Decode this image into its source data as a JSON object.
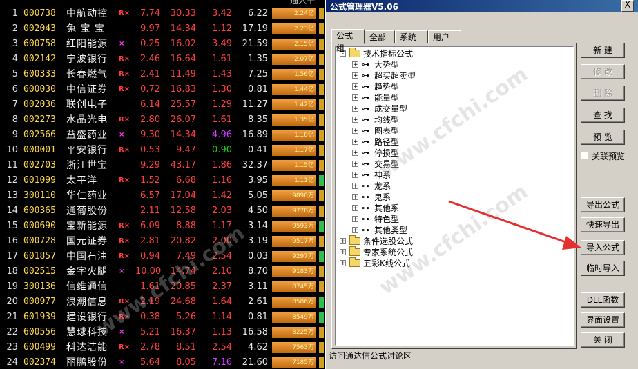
{
  "table": {
    "header_partial": "通入十",
    "rows": [
      {
        "idx": "1",
        "code": "000738",
        "name": "中航动控",
        "mark": "R×",
        "chg": "7.74",
        "price": "30.33",
        "vol": "3.42",
        "x": "6.22",
        "amt": "2.24亿",
        "bar": "y"
      },
      {
        "idx": "2",
        "code": "002043",
        "name": "兔 宝 宝",
        "mark": "",
        "chg": "9.97",
        "price": "14.34",
        "vol": "1.12",
        "x": "17.19",
        "amt": "2.23亿",
        "bar": "y"
      },
      {
        "idx": "3",
        "code": "600758",
        "name": "红阳能源",
        "mark": "×",
        "chg": "0.25",
        "price": "16.02",
        "vol": "3.49",
        "x": "21.59",
        "amt": "2.15亿",
        "bar": "y"
      },
      {
        "idx": "4",
        "code": "002142",
        "name": "宁波银行",
        "mark": "R×",
        "chg": "2.46",
        "price": "16.64",
        "vol": "1.61",
        "x": "1.35",
        "amt": "2.07亿",
        "bar": "y"
      },
      {
        "idx": "5",
        "code": "600333",
        "name": "长春燃气",
        "mark": "R×",
        "chg": "2.41",
        "price": "11.49",
        "vol": "1.43",
        "x": "7.25",
        "amt": "1.56亿",
        "bar": "y"
      },
      {
        "idx": "6",
        "code": "600030",
        "name": "中信证券",
        "mark": "R×",
        "chg": "0.72",
        "price": "16.83",
        "vol": "1.30",
        "x": "0.81",
        "amt": "1.44亿",
        "bar": "y"
      },
      {
        "idx": "7",
        "code": "002036",
        "name": "联创电子",
        "mark": "",
        "chg": "6.14",
        "price": "25.57",
        "vol": "1.29",
        "x": "11.27",
        "amt": "1.42亿",
        "bar": "y"
      },
      {
        "idx": "8",
        "code": "002273",
        "name": "水晶光电",
        "mark": "R×",
        "chg": "2.80",
        "price": "26.07",
        "vol": "1.61",
        "x": "8.35",
        "amt": "1.35亿",
        "bar": "y"
      },
      {
        "idx": "9",
        "code": "002566",
        "name": "益盛药业",
        "mark": "×",
        "chg": "9.30",
        "price": "14.34",
        "vol": "4.96",
        "x": "16.89",
        "amt": "1.18亿",
        "bar": "y",
        "volcolor": "purple"
      },
      {
        "idx": "10",
        "code": "000001",
        "name": "平安银行",
        "mark": "R×",
        "chg": "0.53",
        "price": "9.47",
        "vol": "0.90",
        "x": "0.41",
        "amt": "1.17亿",
        "bar": "y",
        "volcolor": "green"
      },
      {
        "idx": "11",
        "code": "002703",
        "name": "浙江世宝",
        "mark": "",
        "chg": "9.29",
        "price": "43.17",
        "vol": "1.86",
        "x": "32.37",
        "amt": "1.15亿",
        "bar": "y"
      },
      {
        "idx": "12",
        "code": "601099",
        "name": "太平洋",
        "mark": "R×",
        "chg": "1.52",
        "price": "6.68",
        "vol": "1.16",
        "x": "3.95",
        "amt": "1.11亿",
        "bar": "g"
      },
      {
        "idx": "13",
        "code": "300110",
        "name": "华仁药业",
        "mark": "",
        "chg": "6.57",
        "price": "17.04",
        "vol": "1.42",
        "x": "5.05",
        "amt": "9890万",
        "bar": "y"
      },
      {
        "idx": "14",
        "code": "600365",
        "name": "通葡股份",
        "mark": "",
        "chg": "2.11",
        "price": "12.58",
        "vol": "2.03",
        "x": "4.50",
        "amt": "9778万",
        "bar": "y"
      },
      {
        "idx": "15",
        "code": "000690",
        "name": "宝新能源",
        "mark": "R×",
        "chg": "6.09",
        "price": "8.88",
        "vol": "1.17",
        "x": "3.14",
        "amt": "9593万",
        "bar": "g"
      },
      {
        "idx": "16",
        "code": "000728",
        "name": "国元证券",
        "mark": "R×",
        "chg": "2.81",
        "price": "20.82",
        "vol": "2.00",
        "x": "3.19",
        "amt": "9517万",
        "bar": "y"
      },
      {
        "idx": "17",
        "code": "601857",
        "name": "中国石油",
        "mark": "R×",
        "chg": "0.94",
        "price": "7.49",
        "vol": "2.54",
        "x": "0.03",
        "amt": "9297万",
        "bar": "g"
      },
      {
        "idx": "18",
        "code": "002515",
        "name": "金字火腿",
        "mark": "×",
        "chg": "10.00",
        "price": "14.74",
        "vol": "2.10",
        "x": "8.70",
        "amt": "9183万",
        "bar": "y"
      },
      {
        "idx": "19",
        "code": "300136",
        "name": "信维通信",
        "mark": "",
        "chg": "1.61",
        "price": "20.85",
        "vol": "2.37",
        "x": "3.11",
        "amt": "8745万",
        "bar": "y"
      },
      {
        "idx": "20",
        "code": "000977",
        "name": "浪潮信息",
        "mark": "R×",
        "chg": "2.19",
        "price": "24.68",
        "vol": "1.64",
        "x": "2.61",
        "amt": "8586万",
        "bar": "g"
      },
      {
        "idx": "21",
        "code": "601939",
        "name": "建设银行",
        "mark": "R×",
        "chg": "0.38",
        "price": "5.26",
        "vol": "1.14",
        "x": "0.81",
        "amt": "8549万",
        "bar": "g"
      },
      {
        "idx": "22",
        "code": "600556",
        "name": "慧球科技",
        "mark": "×",
        "chg": "5.21",
        "price": "16.37",
        "vol": "1.13",
        "x": "16.58",
        "amt": "8225万",
        "bar": "y"
      },
      {
        "idx": "23",
        "code": "600499",
        "name": "科达洁能",
        "mark": "R×",
        "chg": "2.78",
        "price": "8.51",
        "vol": "2.54",
        "x": "4.62",
        "amt": "7563万",
        "bar": "y"
      },
      {
        "idx": "24",
        "code": "002374",
        "name": "丽鹏股份",
        "mark": "×",
        "chg": "5.64",
        "price": "8.05",
        "vol": "7.16",
        "x": "21.60",
        "amt": "7185万",
        "bar": "y",
        "volcolor": "purple"
      }
    ]
  },
  "dialog": {
    "title": "公式管理器V5.06",
    "close_label": "X",
    "tabs": [
      "公式组",
      "全部",
      "系统",
      "用户"
    ],
    "tree": {
      "root": "技术指标公式",
      "children": [
        "大势型",
        "超买超卖型",
        "趋势型",
        "能量型",
        "成交量型",
        "均线型",
        "图表型",
        "路径型",
        "停损型",
        "交易型",
        "神系",
        "龙系",
        "鬼系",
        "其他系",
        "特色型",
        "其他类型"
      ],
      "others": [
        "条件选股公式",
        "专家系统公式",
        "五彩K线公式"
      ]
    },
    "buttons": {
      "new": "新  建",
      "modify": "修  改",
      "delete": "删  除",
      "find": "查  找",
      "preview": "预  览",
      "export": "导出公式",
      "quick_export": "快速导出",
      "import": "导入公式",
      "temp_import": "临时导入",
      "dll": "DLL函数",
      "ui_settings": "界面设置",
      "close": "关  闭"
    },
    "checkbox_label": "关联预览",
    "status": "访问通达信公式讨论区"
  },
  "watermark": "www.cfchi.com",
  "colors": {
    "accent_arrow": "#e53030",
    "title_bar": "#0a246a",
    "up": "#ff4040"
  }
}
